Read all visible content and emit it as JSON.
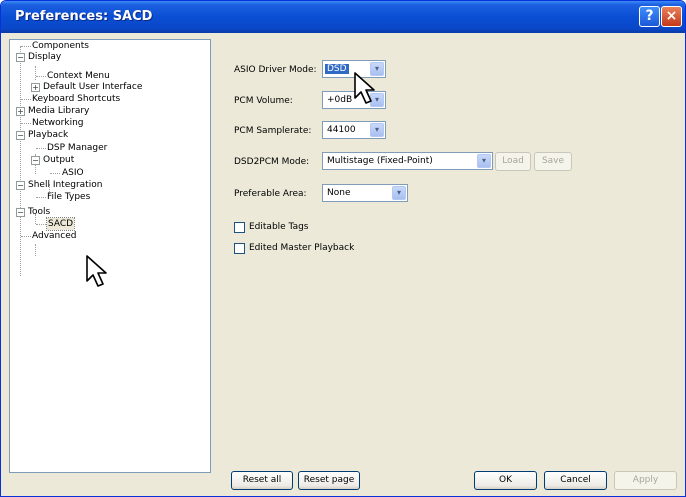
{
  "window": {
    "title": "Preferences: SACD"
  },
  "titlebar_buttons": {
    "help": "?",
    "close": "×"
  },
  "tree": {
    "items": [
      {
        "label": "Components"
      },
      {
        "label": "Display",
        "toggle": "−"
      },
      {
        "label": "Context Menu"
      },
      {
        "label": "Default User Interface",
        "toggle": "+"
      },
      {
        "label": "Keyboard Shortcuts"
      },
      {
        "label": "Media Library",
        "toggle": "+"
      },
      {
        "label": "Networking"
      },
      {
        "label": "Playback",
        "toggle": "−"
      },
      {
        "label": "DSP Manager"
      },
      {
        "label": "Output",
        "toggle": "−"
      },
      {
        "label": "ASIO"
      },
      {
        "label": "Shell Integration",
        "toggle": "−"
      },
      {
        "label": "File Types"
      },
      {
        "label": "Tools",
        "toggle": "−"
      },
      {
        "label": "SACD",
        "selected": true
      },
      {
        "label": "Advanced"
      }
    ]
  },
  "settings": {
    "asio_driver_mode": {
      "label": "ASIO Driver Mode:",
      "value": "DSD"
    },
    "pcm_volume": {
      "label": "PCM Volume:",
      "value": "+0dB"
    },
    "pcm_samplerate": {
      "label": "PCM Samplerate:",
      "value": "44100"
    },
    "dsd2pcm_mode": {
      "label": "DSD2PCM Mode:",
      "value": "Multistage (Fixed-Point)",
      "load": "Load",
      "save": "Save"
    },
    "preferable_area": {
      "label": "Preferable Area:",
      "value": "None"
    },
    "editable_tags": {
      "label": "Editable Tags",
      "checked": false
    },
    "edited_master_playback": {
      "label": "Edited Master Playback",
      "checked": false
    }
  },
  "footer": {
    "reset_all": "Reset all",
    "reset_page": "Reset page",
    "ok": "OK",
    "cancel": "Cancel",
    "apply": "Apply"
  },
  "dropdown_arrow": "▾",
  "colors": {
    "titlebar": "#0a4ed4",
    "selection": "#316ac5",
    "dialog": "#ece9d8"
  }
}
